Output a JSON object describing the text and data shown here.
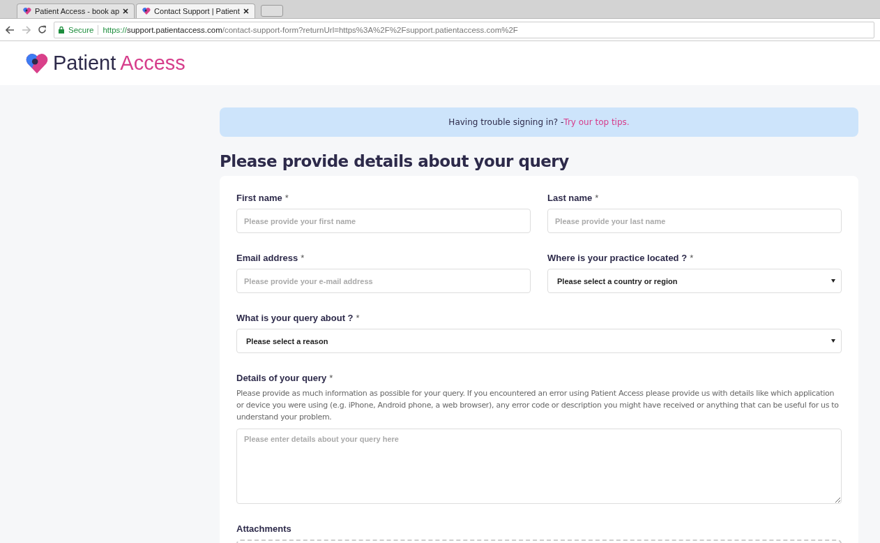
{
  "browser": {
    "tabs": [
      {
        "title": "Patient Access - book ap",
        "selected": false
      },
      {
        "title": "Contact Support | Patient",
        "selected": true
      }
    ],
    "secure_label": "Secure",
    "url": {
      "scheme": "https://",
      "host": "support.patientaccess.com",
      "path": "/contact-support-form?returnUrl=https%3A%2F%2Fsupport.patientaccess.com%2F"
    }
  },
  "logo": {
    "word_1": "Patient",
    "word_2": "Access"
  },
  "banner": {
    "text": "Having trouble signing in? - ",
    "link": "Try our top tips."
  },
  "heading": "Please provide details about your query",
  "fields": [
    {
      "kind": "input",
      "label": "First name",
      "required_mark": "*",
      "placeholder": "Please provide your first name",
      "wide": false
    },
    {
      "kind": "input",
      "label": "Last name",
      "required_mark": "*",
      "placeholder": "Please provide your last name",
      "wide": false
    },
    {
      "kind": "input",
      "label": "Email address",
      "required_mark": "*",
      "placeholder": "Please provide your e-mail address",
      "wide": false
    },
    {
      "kind": "select",
      "label": "Where is your practice located ?",
      "required_mark": "*",
      "value": "Please select a country or region",
      "wide": false
    },
    {
      "kind": "select",
      "label": "What is your query about ?",
      "required_mark": "*",
      "value": "Please select a reason",
      "wide": true
    },
    {
      "kind": "textarea",
      "label": "Details of your query",
      "required_mark": "*",
      "help": "Please provide as much information as possible for your query. If you encountered an error using Patient Access please provide us with details like which application or device you were using (e.g. iPhone, Android phone, a web browser), any error code or description you might have received or anything that can be useful for us to understand your problem.",
      "placeholder": "Please enter details about your query here",
      "wide": true
    },
    {
      "kind": "dropzone",
      "label": "Attachments",
      "wide": true
    }
  ]
}
